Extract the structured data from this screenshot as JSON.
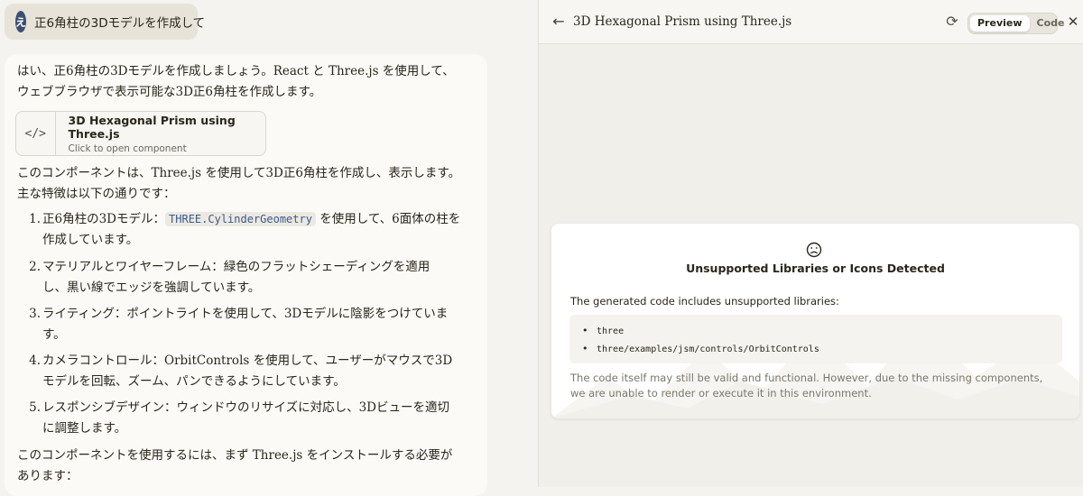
{
  "user_message": {
    "avatar_letter": "え",
    "text": "正6角柱の3Dモデルを作成して"
  },
  "assistant": {
    "intro_lines": [
      "はい、正6角柱の3Dモデルを作成しましょう。React と Three.js を使用して、",
      "ウェブブラウザで表示可能な3D正6角柱を作成します。"
    ],
    "artifact": {
      "icon": "</>",
      "title": "3D Hexagonal Prism using Three.js",
      "subtitle": "Click to open component"
    },
    "description_lines": [
      "このコンポーネントは、Three.js を使用して3D正6角柱を作成し、表示します。",
      "主な特徴は以下の通りです："
    ],
    "features": [
      {
        "num": "1.",
        "before_code": "正6角柱の3Dモデル：",
        "code": "THREE.CylinderGeometry",
        "after_code": " を使用して、6面体の柱を",
        "line2": "作成しています。"
      },
      {
        "num": "2.",
        "line1": "マテリアルとワイヤーフレーム：緑色のフラットシェーディングを適用",
        "line2": "し、黒い線でエッジを強調しています。"
      },
      {
        "num": "3.",
        "line1": "ライティング：ポイントライトを使用して、3Dモデルに陰影をつけていま",
        "line2": "す。"
      },
      {
        "num": "4.",
        "line1": "カメラコントロール：OrbitControls を使用して、ユーザーがマウスで3D",
        "line2": "モデルを回転、ズーム、パンできるようにしています。"
      },
      {
        "num": "5.",
        "line1": "レスポンシブデザイン：ウィンドウのリサイズに対応し、3Dビューを適切",
        "line2": "に調整します。"
      }
    ],
    "closing_lines": [
      "このコンポーネントを使用するには、まず Three.js をインストールする必要が",
      "あります："
    ]
  },
  "panel": {
    "title": "3D Hexagonal Prism using Three.js",
    "tabs": [
      "Preview",
      "Code"
    ],
    "active_tab": "Preview",
    "error": {
      "icon": "sad-face",
      "title": "Unsupported Libraries or Icons Detected",
      "description": "The generated code includes unsupported libraries:",
      "libraries": [
        "three",
        "three/examples/jsm/controls/OrbitControls"
      ],
      "note": "The code itself may still be valid and functional. However, due to the missing components, we are unable to render or execute it in this environment."
    }
  },
  "colors": {
    "background": "#f4f3ef",
    "avatar": "#3d4f74",
    "code_text": "#3a5a8c",
    "muted_text": "#7a776e"
  }
}
